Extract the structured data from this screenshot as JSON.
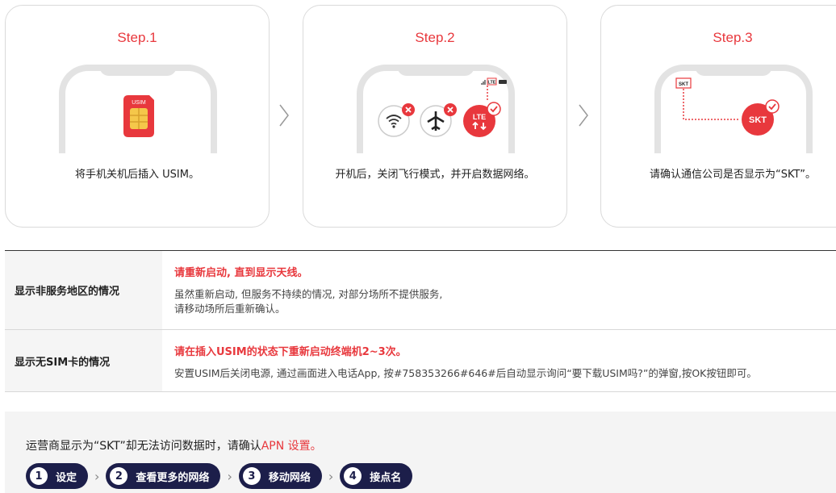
{
  "steps": [
    {
      "title": "Step.1",
      "caption": "将手机关机后插入 USIM。",
      "sim_label": "USIM"
    },
    {
      "title": "Step.2",
      "caption": "开机后，关闭飞行模式，并开启数据网络。",
      "lte_small": "LTE",
      "lte_label": "LTE"
    },
    {
      "title": "Step.3",
      "caption": "请确认通信公司是否显示为“SKT”。",
      "skt_small": "SKT",
      "skt_label": "SKT"
    }
  ],
  "status": [
    {
      "head": "显示非服务地区的情况",
      "title": "请重新启动, 直到显示天线。",
      "desc1": "虽然重新启动, 但服务不持续的情况, 对部分场所不提供服务,",
      "desc2": "请移动场所后重新确认。"
    },
    {
      "head": "显示无SIM卡的情况",
      "title": "请在插入USIM的状态下重新启动终端机2~3次。",
      "desc1": "安置USIM后关闭电源, 通过画面进入电话App, 按#758353266#646#后自动显示询问“要下载USIM吗?”的弹窗,按OK按钮即可。",
      "desc2": ""
    }
  ],
  "apn": {
    "text": "运营商显示为“SKT”却无法访问数据时，请确认",
    "highlight": "APN 设置。",
    "steps": [
      {
        "num": "1",
        "label": "设定"
      },
      {
        "num": "2",
        "label": "查看更多的网络"
      },
      {
        "num": "3",
        "label": "移动网络"
      },
      {
        "num": "4",
        "label": "接点名"
      }
    ]
  },
  "colors": {
    "accent": "#e8383d",
    "navy": "#1c1e4a"
  }
}
